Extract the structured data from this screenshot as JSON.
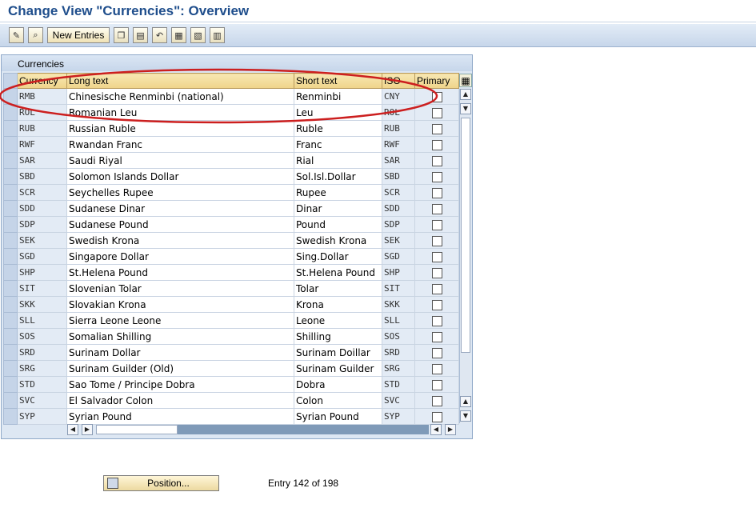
{
  "title": "Change View \"Currencies\": Overview",
  "toolbar": {
    "icons": [
      "display-change-icon",
      "select-icon",
      "copy-icon",
      "delete-icon",
      "undo-icon",
      "select-all-icon",
      "select-block-icon",
      "deselect-all-icon"
    ],
    "new_entries": "New Entries"
  },
  "panel_title": "Currencies",
  "columns": {
    "currency": "Currency",
    "long_text": "Long text",
    "short_text": "Short text",
    "iso": "ISO",
    "primary": "Primary"
  },
  "rows": [
    {
      "currency": "RMB",
      "long_text": "Chinesische Renminbi (national)",
      "short_text": "Renminbi",
      "iso": "CNY"
    },
    {
      "currency": "ROL",
      "long_text": "Romanian Leu",
      "short_text": "Leu",
      "iso": "ROL"
    },
    {
      "currency": "RUB",
      "long_text": "Russian Ruble",
      "short_text": "Ruble",
      "iso": "RUB"
    },
    {
      "currency": "RWF",
      "long_text": "Rwandan Franc",
      "short_text": "Franc",
      "iso": "RWF"
    },
    {
      "currency": "SAR",
      "long_text": "Saudi Riyal",
      "short_text": "Rial",
      "iso": "SAR"
    },
    {
      "currency": "SBD",
      "long_text": "Solomon Islands Dollar",
      "short_text": "Sol.Isl.Dollar",
      "iso": "SBD"
    },
    {
      "currency": "SCR",
      "long_text": "Seychelles Rupee",
      "short_text": "Rupee",
      "iso": "SCR"
    },
    {
      "currency": "SDD",
      "long_text": "Sudanese Dinar",
      "short_text": "Dinar",
      "iso": "SDD"
    },
    {
      "currency": "SDP",
      "long_text": "Sudanese Pound",
      "short_text": "Pound",
      "iso": "SDP"
    },
    {
      "currency": "SEK",
      "long_text": "Swedish Krona",
      "short_text": "Swedish Krona",
      "iso": "SEK"
    },
    {
      "currency": "SGD",
      "long_text": "Singapore Dollar",
      "short_text": "Sing.Dollar",
      "iso": "SGD"
    },
    {
      "currency": "SHP",
      "long_text": "St.Helena Pound",
      "short_text": "St.Helena Pound",
      "iso": "SHP"
    },
    {
      "currency": "SIT",
      "long_text": "Slovenian Tolar",
      "short_text": "Tolar",
      "iso": "SIT"
    },
    {
      "currency": "SKK",
      "long_text": "Slovakian Krona",
      "short_text": "Krona",
      "iso": "SKK"
    },
    {
      "currency": "SLL",
      "long_text": "Sierra Leone Leone",
      "short_text": "Leone",
      "iso": "SLL"
    },
    {
      "currency": "SOS",
      "long_text": "Somalian Shilling",
      "short_text": "Shilling",
      "iso": "SOS"
    },
    {
      "currency": "SRD",
      "long_text": "Surinam Dollar",
      "short_text": "Surinam Doillar",
      "iso": "SRD"
    },
    {
      "currency": "SRG",
      "long_text": "Surinam Guilder (Old)",
      "short_text": "Surinam Guilder",
      "iso": "SRG"
    },
    {
      "currency": "STD",
      "long_text": "Sao Tome / Principe Dobra",
      "short_text": "Dobra",
      "iso": "STD"
    },
    {
      "currency": "SVC",
      "long_text": "El Salvador Colon",
      "short_text": "Colon",
      "iso": "SVC"
    },
    {
      "currency": "SYP",
      "long_text": "Syrian Pound",
      "short_text": "Syrian Pound",
      "iso": "SYP"
    }
  ],
  "position_button": "Position...",
  "entry_status": "Entry 142 of 198",
  "highlight_color": "#cc1f1f"
}
